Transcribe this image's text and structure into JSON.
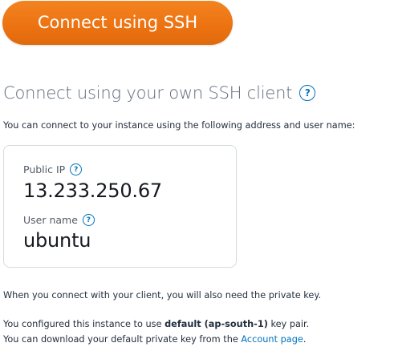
{
  "connect_button": {
    "label": "Connect using SSH"
  },
  "own_client": {
    "title": "Connect using your own SSH client",
    "help_glyph": "?",
    "intro": "You can connect to your instance using the following address and user name:"
  },
  "connection_info": {
    "public_ip_label": "Public IP",
    "public_ip_value": "13.233.250.67",
    "user_name_label": "User name",
    "user_name_value": "ubuntu",
    "help_glyph": "?"
  },
  "notes": {
    "private_key_note": "When you connect with your client, you will also need the private key.",
    "key_pair_prefix": "You configured this instance to use ",
    "key_pair_name": "default (ap-south-1)",
    "key_pair_suffix": " key pair.",
    "download_prefix": "You can download your default private key from the ",
    "account_link": "Account page",
    "download_suffix": "."
  },
  "colors": {
    "button_orange": "#ec7211",
    "link_blue": "#0073bb",
    "title_gray": "#5f6b7a",
    "card_border": "#d5dbdb"
  },
  "icons": {
    "help": "help-circle-icon"
  }
}
